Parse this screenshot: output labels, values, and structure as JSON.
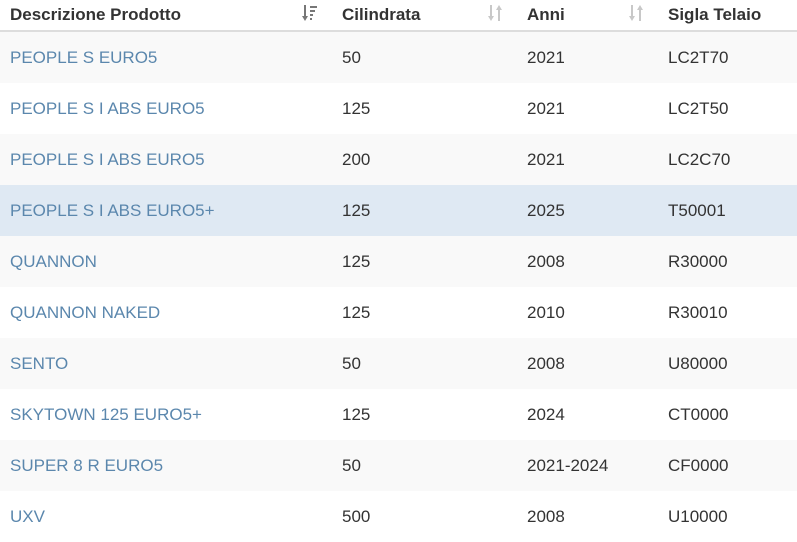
{
  "table": {
    "headers": [
      {
        "label": "Descrizione Prodotto",
        "sort_icon": "sort-amount-down-icon",
        "sort_state": "active"
      },
      {
        "label": "Cilindrata",
        "sort_icon": "sort-both-icon",
        "sort_state": "idle"
      },
      {
        "label": "Anni",
        "sort_icon": "sort-both-icon",
        "sort_state": "idle"
      },
      {
        "label": "Sigla Telaio",
        "sort_icon": "",
        "sort_state": "none"
      }
    ],
    "rows": [
      {
        "product": "PEOPLE S EURO5",
        "cilindrata": "50",
        "anni": "2021",
        "telaio": "LC2T70"
      },
      {
        "product": "PEOPLE S I ABS EURO5",
        "cilindrata": "125",
        "anni": "2021",
        "telaio": "LC2T50"
      },
      {
        "product": "PEOPLE S I ABS EURO5",
        "cilindrata": "200",
        "anni": "2021",
        "telaio": "LC2C70"
      },
      {
        "product": "PEOPLE S I ABS EURO5+",
        "cilindrata": "125",
        "anni": "2025",
        "telaio": "T50001"
      },
      {
        "product": "QUANNON",
        "cilindrata": "125",
        "anni": "2008",
        "telaio": "R30000"
      },
      {
        "product": "QUANNON NAKED",
        "cilindrata": "125",
        "anni": "2010",
        "telaio": "R30010"
      },
      {
        "product": "SENTO",
        "cilindrata": "50",
        "anni": "2008",
        "telaio": "U80000"
      },
      {
        "product": "SKYTOWN 125 EURO5+",
        "cilindrata": "125",
        "anni": "2024",
        "telaio": "CT0000"
      },
      {
        "product": "SUPER 8 R EURO5",
        "cilindrata": "50",
        "anni": "2021-2024",
        "telaio": "CF0000"
      },
      {
        "product": "UXV",
        "cilindrata": "500",
        "anni": "2008",
        "telaio": "U10000"
      }
    ],
    "highlighted_row": 3
  },
  "colors": {
    "link": "#5b87ad",
    "highlight": "#dfe9f3",
    "stripe": "#f9f9f9"
  }
}
